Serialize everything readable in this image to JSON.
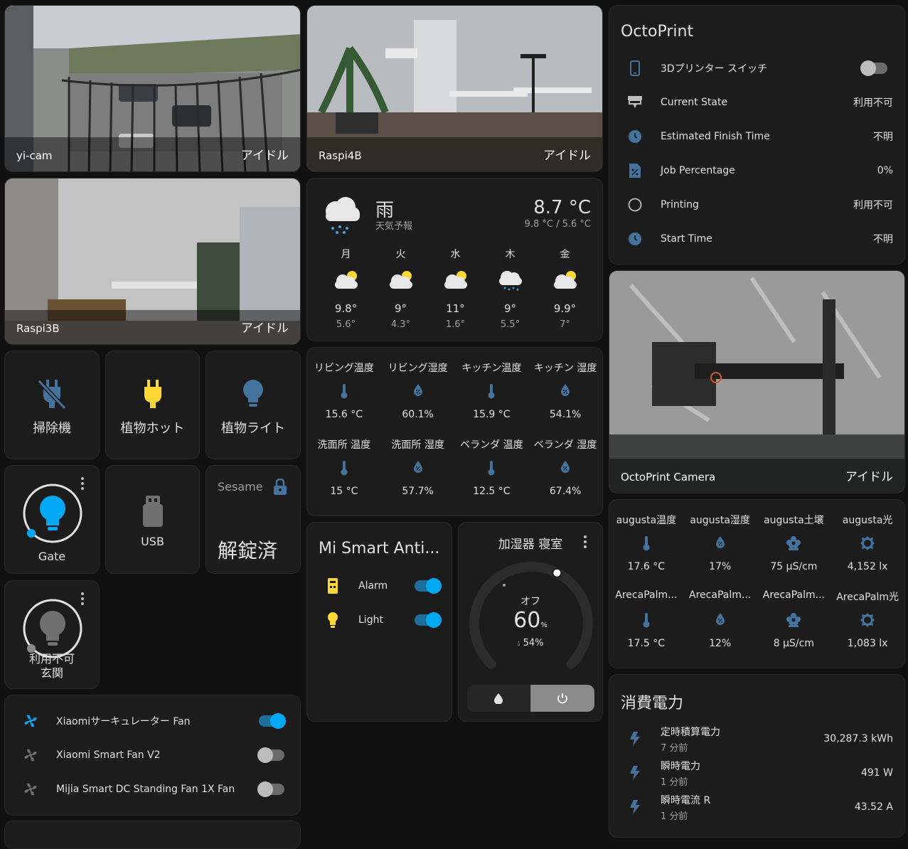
{
  "cameras": [
    {
      "name": "yi-cam",
      "state": "アイドル"
    },
    {
      "name": "Raspi4B",
      "state": "アイドル"
    },
    {
      "name": "Raspi3B",
      "state": "アイドル"
    },
    {
      "name": "OctoPrint Camera",
      "state": "アイドル"
    }
  ],
  "buttons": {
    "vacuum": "掃除機",
    "plant_hot": "植物ホット",
    "plant_light": "植物ライト",
    "usb": "USB"
  },
  "gate": {
    "label": "Gate"
  },
  "entrance": {
    "status": "利用不可",
    "label": "玄関"
  },
  "sesame": {
    "name": "Sesame",
    "state": "解錠済"
  },
  "fans": [
    {
      "name": "Xiaomiサーキュレーター Fan",
      "on": true
    },
    {
      "name": "Xiaomi Smart Fan V2",
      "on": false
    },
    {
      "name": "Mijia Smart DC Standing Fan 1X Fan",
      "on": false
    }
  ],
  "weather": {
    "condition": "雨",
    "subtitle": "天気予報",
    "temperature": "8.7 °C",
    "range": "9.8 °C / 5.6 °C",
    "forecast": [
      {
        "day": "月",
        "hi": "9.8°",
        "lo": "5.6°",
        "icon": "partly-cloudy-icon"
      },
      {
        "day": "火",
        "hi": "9°",
        "lo": "4.3°",
        "icon": "partly-cloudy-icon"
      },
      {
        "day": "水",
        "hi": "11°",
        "lo": "1.6°",
        "icon": "partly-cloudy-icon"
      },
      {
        "day": "木",
        "hi": "9°",
        "lo": "5.5°",
        "icon": "rainy-icon"
      },
      {
        "day": "金",
        "hi": "9.9°",
        "lo": "7°",
        "icon": "partly-cloudy-icon"
      }
    ]
  },
  "home_sensors": [
    {
      "name": "リビング温度",
      "value": "15.6 °C",
      "icon": "thermometer-icon"
    },
    {
      "name": "リビング湿度",
      "value": "60.1%",
      "icon": "water-percent-icon"
    },
    {
      "name": "キッチン温度",
      "value": "15.9 °C",
      "icon": "thermometer-icon"
    },
    {
      "name": "キッチン 湿度",
      "value": "54.1%",
      "icon": "water-percent-icon"
    },
    {
      "name": "洗面所 温度",
      "value": "15 °C",
      "icon": "thermometer-icon"
    },
    {
      "name": "洗面所 湿度",
      "value": "57.7%",
      "icon": "water-percent-icon"
    },
    {
      "name": "ベランダ 温度",
      "value": "12.5 °C",
      "icon": "thermometer-icon"
    },
    {
      "name": "ベランダ 湿度",
      "value": "67.4%",
      "icon": "water-percent-icon"
    }
  ],
  "mi_antenna": {
    "title": "Mi Smart Anti...",
    "rows": [
      {
        "name": "Alarm",
        "on": true
      },
      {
        "name": "Light",
        "on": true
      }
    ]
  },
  "humidifier": {
    "title": "加湿器 寝室",
    "state": "オフ",
    "target": "60",
    "unit": "%",
    "current": "54%",
    "level": 0.6
  },
  "octoprint": {
    "title": "OctoPrint",
    "rows": [
      {
        "name": "3Dプリンター スイッチ",
        "value": "",
        "icon": "cellphone-icon"
      },
      {
        "name": "Current State",
        "value": "利用不可",
        "icon": "printer-3d-icon"
      },
      {
        "name": "Estimated Finish Time",
        "value": "不明",
        "icon": "clock-icon"
      },
      {
        "name": "Job Percentage",
        "value": "0%",
        "icon": "file-percent-icon"
      },
      {
        "name": "Printing",
        "value": "利用不可",
        "icon": "circle-outline-icon"
      },
      {
        "name": "Start Time",
        "value": "不明",
        "icon": "clock-icon"
      }
    ]
  },
  "plant_sensors": [
    {
      "name": "augusta温度",
      "value": "17.6 °C",
      "icon": "thermometer-icon"
    },
    {
      "name": "augusta湿度",
      "value": "17%",
      "icon": "water-percent-icon"
    },
    {
      "name": "augusta土壌",
      "value": "75 µS/cm",
      "icon": "flower-icon"
    },
    {
      "name": "augusta光",
      "value": "4,152 lx",
      "icon": "brightness-icon"
    },
    {
      "name": "ArecaPalm...",
      "value": "17.5 °C",
      "icon": "thermometer-icon"
    },
    {
      "name": "ArecaPalm...",
      "value": "12%",
      "icon": "water-percent-icon"
    },
    {
      "name": "ArecaPalm...",
      "value": "8 µS/cm",
      "icon": "flower-icon"
    },
    {
      "name": "ArecaPalm光",
      "value": "1,083 lx",
      "icon": "brightness-icon"
    }
  ],
  "power": {
    "title": "消費電力",
    "rows": [
      {
        "name": "定時積算電力",
        "time": "7 分前",
        "value": "30,287.3 kWh"
      },
      {
        "name": "瞬時電力",
        "time": "1 分前",
        "value": "491 W"
      },
      {
        "name": "瞬時電流 R",
        "time": "1 分前",
        "value": "43.52 A"
      }
    ]
  },
  "colors": {
    "accent": "#03a9f4",
    "icon_blue": "#44739e",
    "yellow": "#fdd835",
    "card": "#1c1c1c",
    "bg": "#111111"
  }
}
